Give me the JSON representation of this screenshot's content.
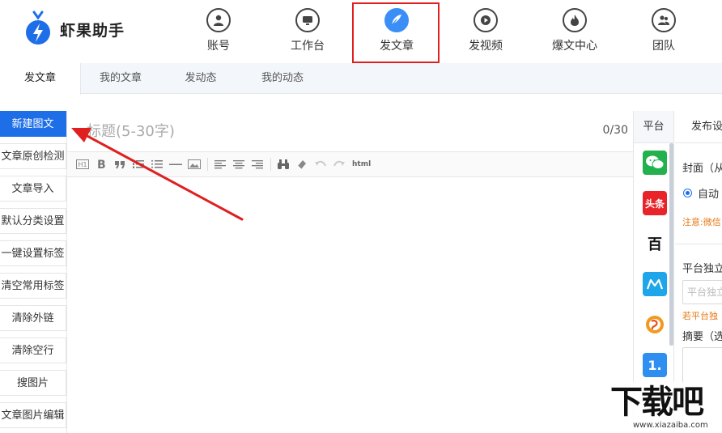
{
  "app": {
    "name": "虾果助手",
    "brand_color": "#1e6ee8"
  },
  "nav": {
    "items": [
      {
        "label": "账号",
        "icon": "user-icon"
      },
      {
        "label": "工作台",
        "icon": "monitor-icon"
      },
      {
        "label": "发文章",
        "icon": "feather-icon",
        "active": true
      },
      {
        "label": "发视频",
        "icon": "play-icon"
      },
      {
        "label": "爆文中心",
        "icon": "flame-icon"
      },
      {
        "label": "团队",
        "icon": "team-icon"
      }
    ]
  },
  "subtabs": [
    {
      "label": "发文章",
      "active": true
    },
    {
      "label": "我的文章"
    },
    {
      "label": "发动态"
    },
    {
      "label": "我的动态"
    }
  ],
  "sidebar": {
    "items": [
      {
        "label": "新建图文",
        "primary": true
      },
      {
        "label": "文章原创检测"
      },
      {
        "label": "文章导入"
      },
      {
        "label": "默认分类设置"
      },
      {
        "label": "一键设置标签"
      },
      {
        "label": "清空常用标签"
      },
      {
        "label": "清除外链"
      },
      {
        "label": "清除空行"
      },
      {
        "label": "搜图片"
      },
      {
        "label": "文章图片编辑"
      }
    ]
  },
  "editor": {
    "title_placeholder": "标题(5-30字)",
    "counter": "0/30",
    "toolbar_html_label": "html",
    "toolbar_buttons": [
      "h1-icon",
      "bold-icon",
      "quote-icon",
      "ordered-list-icon",
      "unordered-list-icon",
      "hr-icon",
      "image-icon",
      "align-left-icon",
      "align-center-icon",
      "align-right-icon",
      "binoculars-icon",
      "eraser-icon",
      "undo-icon",
      "redo-icon"
    ]
  },
  "platforms": {
    "header": "平台",
    "items": [
      {
        "name": "wechat-icon",
        "color": "#22b14c"
      },
      {
        "name": "toutiao-icon",
        "color": "#e8232a",
        "text": "头条"
      },
      {
        "name": "baijiahao-icon",
        "color": "#111111",
        "text": "百"
      },
      {
        "name": "dayu-icon",
        "color": "#1fa6ea"
      },
      {
        "name": "sohu-icon",
        "color": "#f39a1e"
      },
      {
        "name": "yidian-icon",
        "color": "#2f8ff0",
        "text": "1."
      }
    ]
  },
  "settings": {
    "header": "发布设",
    "cover_label": "封面（从",
    "cover_option": "自动",
    "cover_note": "注意:微信",
    "standalone_label": "平台独立",
    "standalone_placeholder": "平台独立",
    "standalone_note": "若平台独",
    "summary_label": "摘要（选"
  },
  "watermark": {
    "big": "下载吧",
    "small": "www.xiazaiba.com"
  }
}
